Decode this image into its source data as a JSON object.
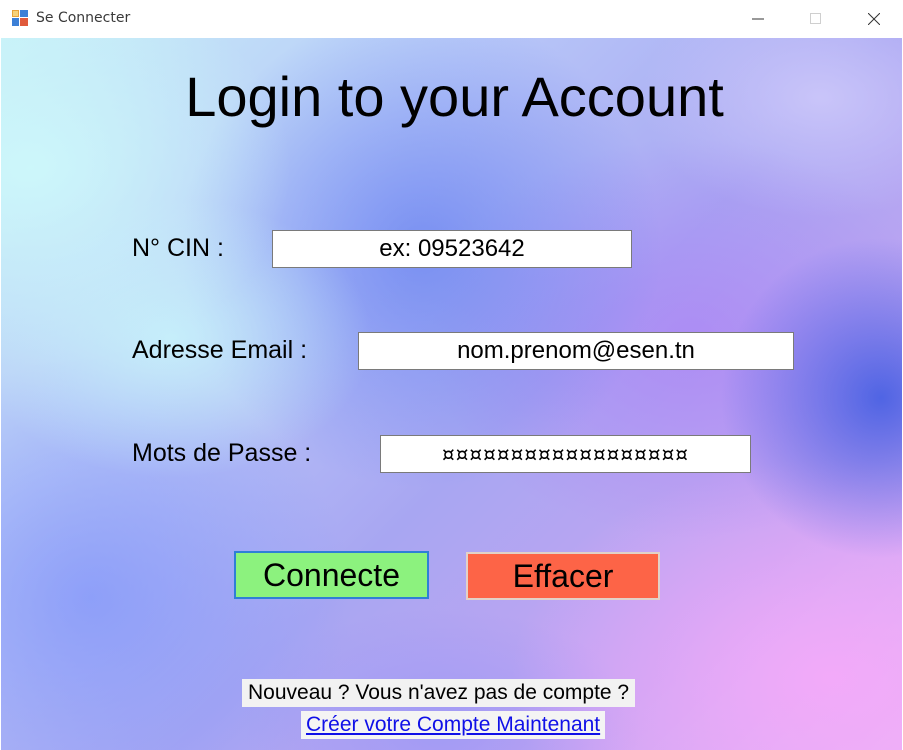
{
  "window": {
    "title": "Se Connecter",
    "icon": "winforms-app-icon",
    "controls": {
      "minimize": "minimize-icon",
      "maximize": "maximize-icon",
      "close": "close-icon"
    }
  },
  "form": {
    "heading": "Login to your Account",
    "cin": {
      "label": "N° CIN :",
      "value": "ex: 09523642"
    },
    "email": {
      "label": "Adresse Email :",
      "value": "nom.prenom@esen.tn"
    },
    "password": {
      "label": "Mots de Passe :",
      "value": "¤¤¤¤¤¤¤¤¤¤¤¤¤¤¤¤¤¤"
    },
    "buttons": {
      "connect": "Connecte",
      "clear": "Effacer"
    },
    "signup": {
      "prompt": "Nouveau ?  Vous n'avez pas de compte ?",
      "link": "Créer votre Compte Maintenant"
    }
  },
  "colors": {
    "connect_button": "#8cf27e",
    "connect_border": "#2f7fd6",
    "clear_button": "#fd6447",
    "link": "#1010e8"
  }
}
